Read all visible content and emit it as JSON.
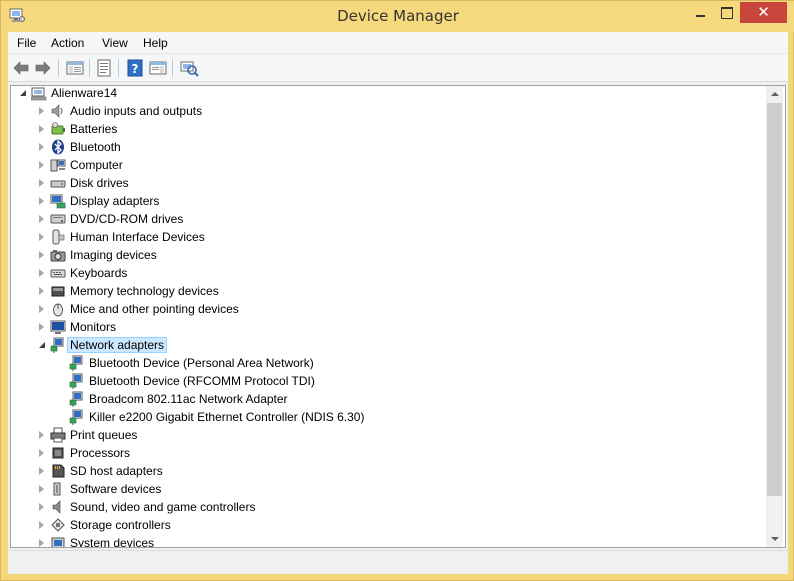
{
  "window": {
    "title": "Device Manager",
    "close_glyph": "✕",
    "frame_color": "#f7d97d"
  },
  "menu": [
    {
      "label": "File"
    },
    {
      "label": "Action"
    },
    {
      "label": "View"
    },
    {
      "label": "Help"
    }
  ],
  "toolbar": [
    {
      "icon": "back-arrow-icon"
    },
    {
      "icon": "forward-arrow-icon"
    },
    {
      "icon": "show-hide-console-tree-icon"
    },
    {
      "icon": "properties-icon"
    },
    {
      "icon": "help-icon"
    },
    {
      "icon": "action-pane-icon"
    },
    {
      "icon": "scan-hardware-changes-icon"
    }
  ],
  "tree": {
    "root": {
      "label": "Alienware14",
      "icon": "computer-root-icon"
    },
    "categories": [
      {
        "label": "Audio inputs and outputs",
        "icon": "speaker-icon"
      },
      {
        "label": "Batteries",
        "icon": "battery-icon"
      },
      {
        "label": "Bluetooth",
        "icon": "bluetooth-icon"
      },
      {
        "label": "Computer",
        "icon": "computer-icon"
      },
      {
        "label": "Disk drives",
        "icon": "disk-drive-icon"
      },
      {
        "label": "Display adapters",
        "icon": "display-adapter-icon"
      },
      {
        "label": "DVD/CD-ROM drives",
        "icon": "dvd-drive-icon"
      },
      {
        "label": "Human Interface Devices",
        "icon": "hid-icon"
      },
      {
        "label": "Imaging devices",
        "icon": "camera-icon"
      },
      {
        "label": "Keyboards",
        "icon": "keyboard-icon"
      },
      {
        "label": "Memory technology devices",
        "icon": "memory-card-icon"
      },
      {
        "label": "Mice and other pointing devices",
        "icon": "mouse-icon"
      },
      {
        "label": "Monitors",
        "icon": "monitor-icon"
      },
      {
        "label": "Network adapters",
        "icon": "network-adapter-icon",
        "expanded": true,
        "selected": true,
        "children": [
          {
            "label": "Bluetooth Device (Personal Area Network)",
            "icon": "network-adapter-icon"
          },
          {
            "label": "Bluetooth Device (RFCOMM Protocol TDI)",
            "icon": "network-adapter-icon"
          },
          {
            "label": "Broadcom 802.11ac Network Adapter",
            "icon": "network-adapter-icon"
          },
          {
            "label": "Killer e2200 Gigabit Ethernet Controller (NDIS 6.30)",
            "icon": "network-adapter-icon"
          }
        ]
      },
      {
        "label": "Print queues",
        "icon": "printer-icon"
      },
      {
        "label": "Processors",
        "icon": "processor-icon"
      },
      {
        "label": "SD host adapters",
        "icon": "sd-card-icon"
      },
      {
        "label": "Software devices",
        "icon": "software-device-icon"
      },
      {
        "label": "Sound, video and game controllers",
        "icon": "sound-icon"
      },
      {
        "label": "Storage controllers",
        "icon": "storage-controller-icon"
      },
      {
        "label": "System devices",
        "icon": "system-device-icon"
      }
    ]
  },
  "colors": {
    "selection_bg": "#cce8ff",
    "selection_border": "#99d1ff",
    "close_button": "#c8463c"
  }
}
